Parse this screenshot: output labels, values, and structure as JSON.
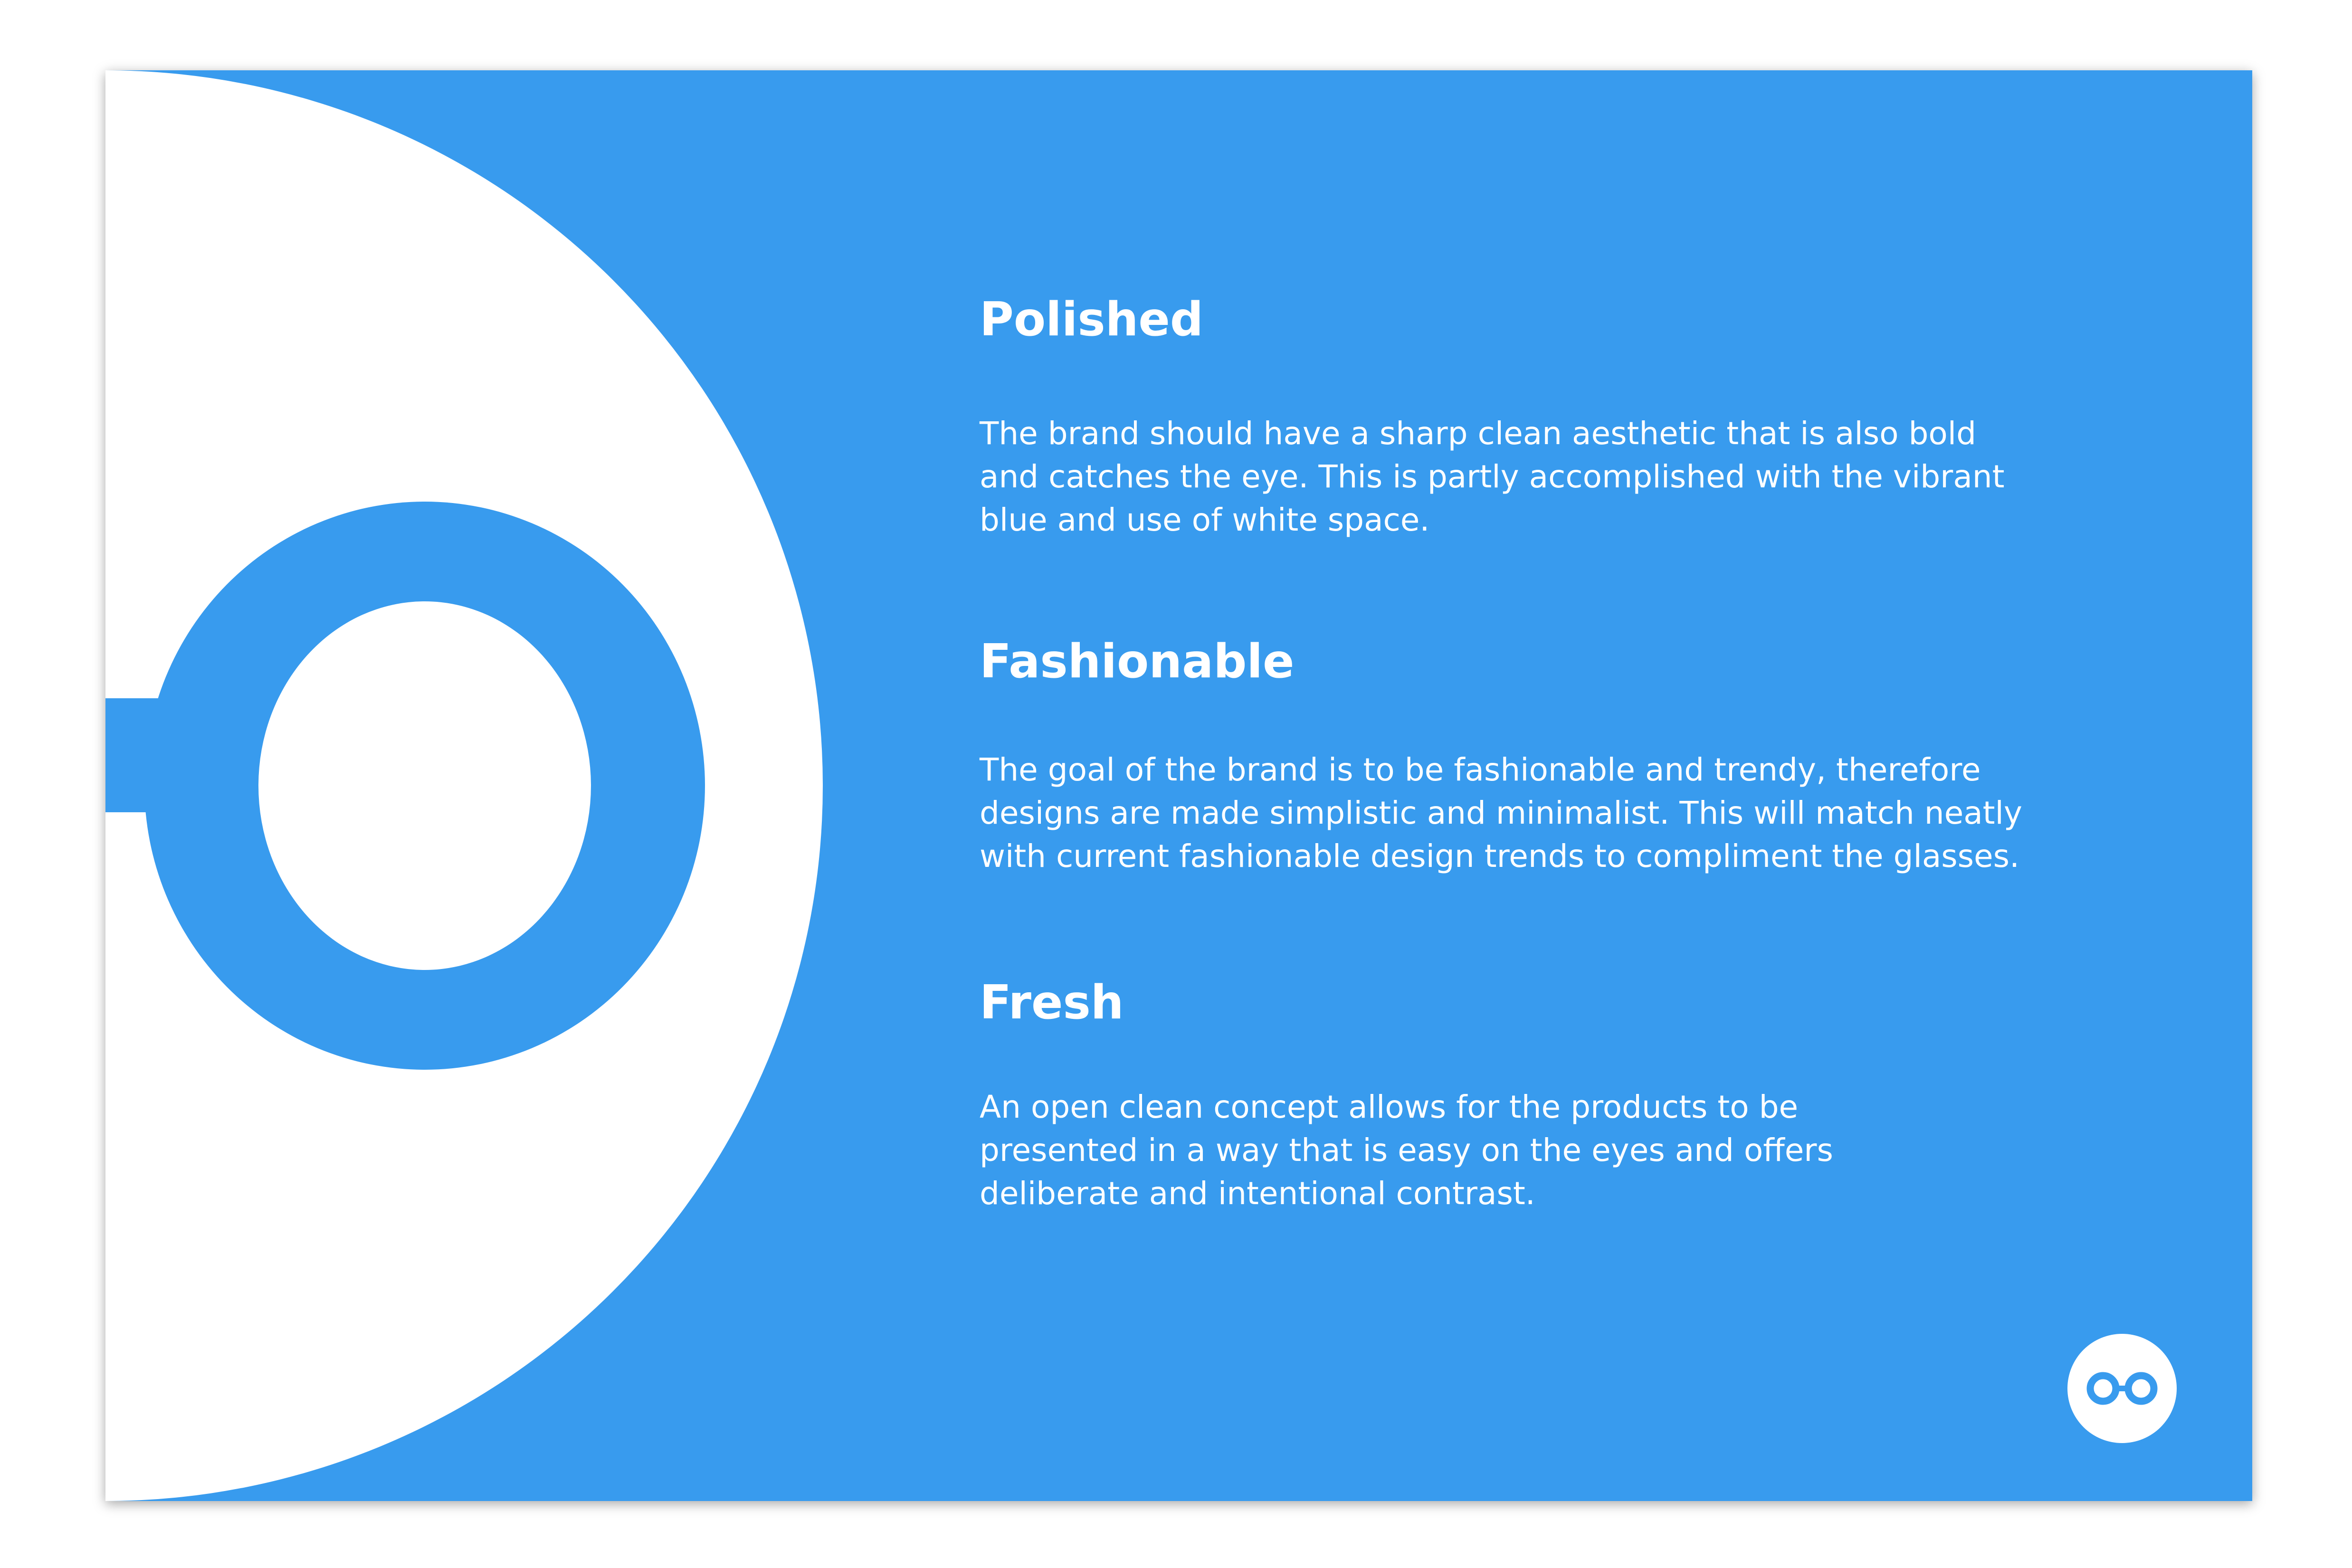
{
  "colors": {
    "brand_blue": "#389bee",
    "white": "#ffffff"
  },
  "sections": [
    {
      "heading": "Polished",
      "lines": [
        "The brand should have a sharp clean aesthetic that is also bold",
        "and catches the eye. This is partly accomplished with the vibrant",
        "blue and use of white space."
      ]
    },
    {
      "heading": "Fashionable",
      "lines": [
        "The goal of the brand is to be fashionable and trendy, therefore",
        "designs are made simplistic and minimalist. This will match neatly",
        "with current fashionable design trends to compliment the glasses."
      ]
    },
    {
      "heading": "Fresh",
      "lines": [
        "An open clean concept allows for the products to be",
        "presented in a way that is easy on the eyes and offers",
        "deliberate and intentional contrast."
      ]
    }
  ],
  "icons": {
    "large_mark": "glasses-lens-icon",
    "corner_logo": "glasses-logo-icon"
  }
}
